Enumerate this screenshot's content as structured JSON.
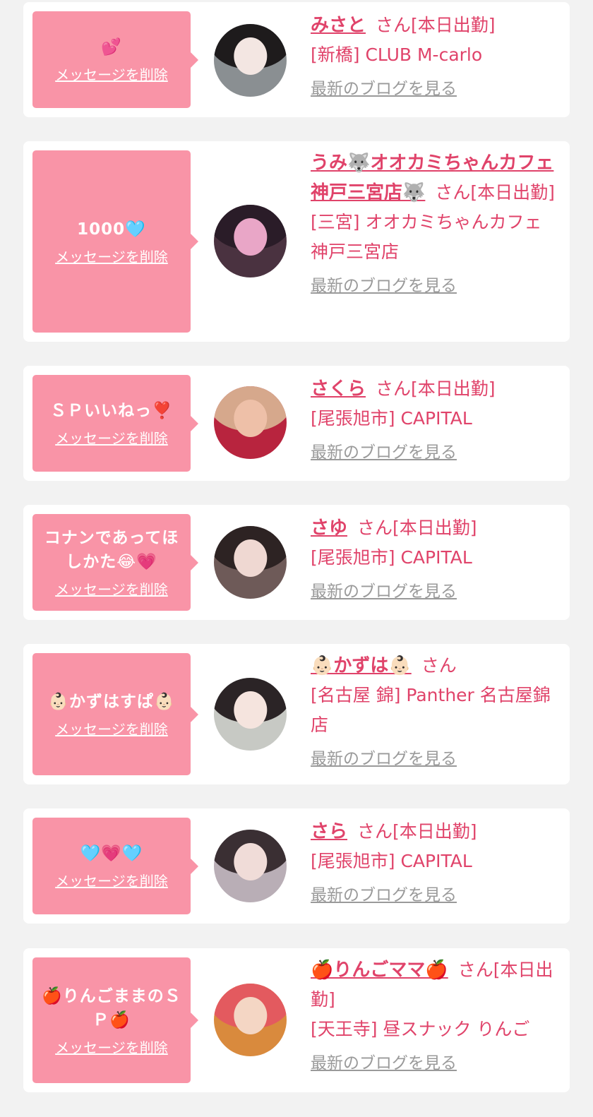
{
  "delete_label": "メッセージを削除",
  "blog_label": "最新のブログを見る",
  "cards": [
    {
      "message": "💕",
      "name": "みさと",
      "suffix": "さん[本日出勤]",
      "shop": "[新橋] CLUB M-carlo"
    },
    {
      "message": "1000🩵",
      "name": "うみ🐺オオカミちゃんカフェ神戸三宮店🐺",
      "suffix": "さん[本日出勤]",
      "shop": "[三宮] オオカミちゃんカフェ神戸三宮店"
    },
    {
      "message": "ＳＰいいねっ❣️",
      "name": "さくら",
      "suffix": "さん[本日出勤]",
      "shop": "[尾張旭市] CAPITAL"
    },
    {
      "message": "コナンであってほしかた😂💗",
      "name": "さゆ",
      "suffix": "さん[本日出勤]",
      "shop": "[尾張旭市] CAPITAL"
    },
    {
      "message": "👶🏻かずはすぱ👶🏻",
      "name": "👶🏻かずは👶🏻",
      "suffix": "さん",
      "shop": "[名古屋 錦] Panther 名古屋錦店"
    },
    {
      "message": "🩵💗🩵",
      "name": "さら",
      "suffix": "さん[本日出勤]",
      "shop": "[尾張旭市] CAPITAL"
    },
    {
      "message": "🍎りんごままのＳＰ🍎",
      "name": "🍎りんごママ🍎",
      "suffix": "さん[本日出勤]",
      "shop": "[天王寺] 昼スナック りんご"
    }
  ],
  "colors": {
    "accent": "#e0436a",
    "bubble": "#f994a7",
    "link_gray": "#9a9a9a",
    "background": "#f2f2f2"
  }
}
